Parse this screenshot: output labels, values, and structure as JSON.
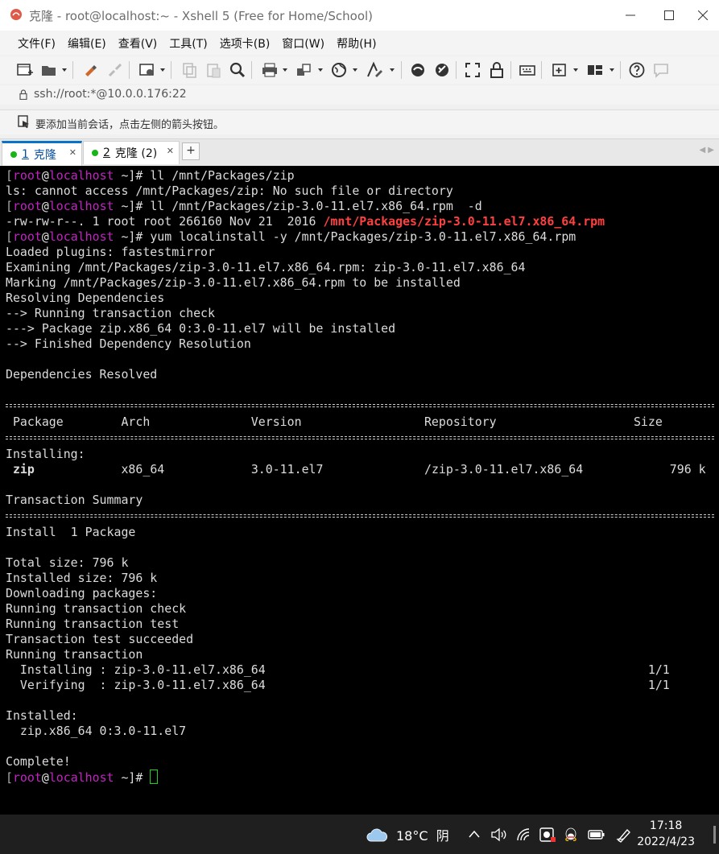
{
  "window": {
    "title": "克隆 - root@localhost:~ - Xshell 5 (Free for Home/School)"
  },
  "menu": [
    "文件(F)",
    "编辑(E)",
    "查看(V)",
    "工具(T)",
    "选项卡(B)",
    "窗口(W)",
    "帮助(H)"
  ],
  "toolbar": {
    "icons": [
      "new-session-icon",
      "open-folder-icon",
      "reconnect-icon",
      "disconnect-icon",
      "properties-icon",
      "copy-icon",
      "paste-icon",
      "find-icon",
      "print-icon",
      "transfer-icon",
      "globe-icon",
      "font-icon",
      "xftp-icon",
      "xmanager-icon",
      "fullscreen-icon",
      "lock-icon",
      "keyboard-icon",
      "add-tab-icon",
      "layout-icon",
      "help-icon",
      "chat-icon"
    ]
  },
  "address": {
    "url": "ssh://root:*@10.0.0.176:22"
  },
  "hint": {
    "text": "要添加当前会话，点击左侧的箭头按钮。"
  },
  "tabs": [
    {
      "number": "1",
      "label": "克隆",
      "active": true
    },
    {
      "number": "2",
      "label": "克隆 (2)",
      "active": false
    }
  ],
  "prompt": {
    "open": "[",
    "user": "root",
    "at": "@",
    "host": "localhost",
    "rest": " ~]# "
  },
  "terminal": {
    "cmd1": "ll /mnt/Packages/zip",
    "out1": "ls: cannot access /mnt/Packages/zip: No such file or directory",
    "cmd2": "ll /mnt/Packages/zip-3.0-11.el7.x86_64.rpm  -d",
    "out2_prefix": "-rw-rw-r--. 1 root root 266160 Nov 21  2016 ",
    "out2_file": "/mnt/Packages/zip-3.0-11.el7.x86_64.rpm",
    "cmd3": "yum localinstall -y /mnt/Packages/zip-3.0-11.el7.x86_64.rpm",
    "install_log": [
      "Loaded plugins: fastestmirror",
      "Examining /mnt/Packages/zip-3.0-11.el7.x86_64.rpm: zip-3.0-11.el7.x86_64",
      "Marking /mnt/Packages/zip-3.0-11.el7.x86_64.rpm to be installed",
      "Resolving Dependencies",
      "--> Running transaction check",
      "---> Package zip.x86_64 0:3.0-11.el7 will be installed",
      "--> Finished Dependency Resolution",
      "",
      "Dependencies Resolved",
      ""
    ],
    "table_header": " Package        Arch              Version                 Repository                   Size",
    "installing_label": "Installing:",
    "package_row": {
      "name": " zip",
      "rest": "            x86_64            3.0-11.el7              /zip-3.0-11.el7.x86_64            796 k"
    },
    "transaction_summary": "Transaction Summary",
    "install_count": "Install  1 Package",
    "post_log": [
      "",
      "Total size: 796 k",
      "Installed size: 796 k",
      "Downloading packages:",
      "Running transaction check",
      "Running transaction test",
      "Transaction test succeeded",
      "Running transaction",
      "  Installing : zip-3.0-11.el7.x86_64                                                     1/1",
      "  Verifying  : zip-3.0-11.el7.x86_64                                                     1/1",
      "",
      "Installed:",
      "  zip.x86_64 0:3.0-11.el7",
      "",
      "Complete!"
    ]
  },
  "taskbar": {
    "weather": "18°C  阴",
    "time": "17:18",
    "date": "2022/4/23"
  },
  "colors": {
    "terminal_bg": "#000000",
    "terminal_fg": "#dcdcdc",
    "prompt_magenta": "#c224c2",
    "highlight_red": "#ff4040",
    "cursor_green": "#20d020",
    "tab_accent": "#0a73c8"
  }
}
